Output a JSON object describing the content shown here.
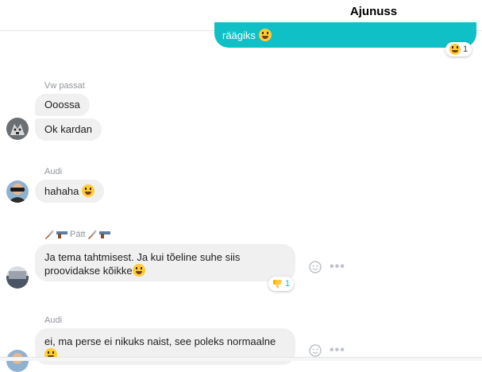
{
  "header": {
    "title": "Ajunuss"
  },
  "outgoing": {
    "text": "räägiks",
    "reaction_count": "1"
  },
  "groups": [
    {
      "sender": "Vw passat",
      "messages": [
        "Ooossa",
        "Ok kardan"
      ]
    },
    {
      "sender": "Audi",
      "messages": [
        "hahaha"
      ]
    },
    {
      "sender": "Pätt",
      "messages": [
        "Ja tema tahtmisest. Ja kui tõeline suhe siis",
        "proovidakse kõikke"
      ],
      "reaction_count": "1"
    },
    {
      "sender": "Audi",
      "messages": [
        "ei, ma perse ei nikuks naist, see poleks normaalne"
      ]
    }
  ],
  "icons": {
    "emoji": "grinning-face-icon",
    "reaction_laugh": "laughing-face-icon",
    "reaction_thumbs_down": "thumbs-down-icon",
    "react_button": "smiley-icon",
    "more": "more-dots-icon"
  },
  "colors": {
    "accent": "#0fc0c7",
    "bubble": "#f1f0f0",
    "sender_text": "#90949c"
  }
}
